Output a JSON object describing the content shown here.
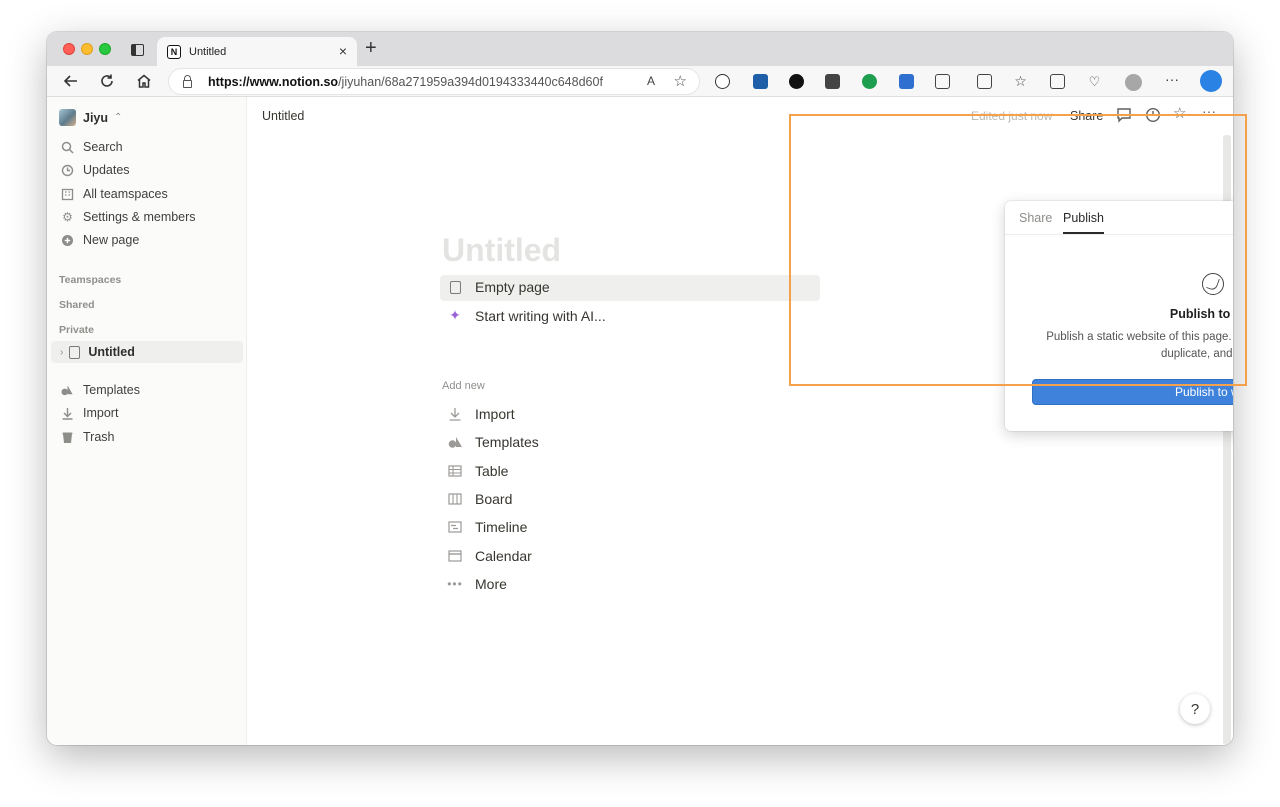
{
  "browser": {
    "tab_title": "Untitled",
    "tab_close": "×",
    "new_tab": "+",
    "url_host": "https://www.notion.so",
    "url_path": "/jiyuhan/68a271959a394d0194333440c648d60f",
    "read_aloud": "A",
    "more": "···"
  },
  "sidebar": {
    "workspace": "Jiyu",
    "nav": [
      {
        "label": "Search",
        "icon": "search-icon"
      },
      {
        "label": "Updates",
        "icon": "clock-icon"
      },
      {
        "label": "All teamspaces",
        "icon": "building-icon"
      },
      {
        "label": "Settings & members",
        "icon": "gear-icon"
      },
      {
        "label": "New page",
        "icon": "plus-circle-icon"
      }
    ],
    "sections": {
      "teamspaces": "Teamspaces",
      "shared": "Shared",
      "private": "Private"
    },
    "private_page": "Untitled",
    "bottom": [
      {
        "label": "Templates",
        "icon": "shapes-icon"
      },
      {
        "label": "Import",
        "icon": "download-icon"
      },
      {
        "label": "Trash",
        "icon": "trash-icon"
      }
    ]
  },
  "header": {
    "breadcrumb": "Untitled",
    "edited": "Edited just now",
    "share": "Share"
  },
  "page": {
    "title_placeholder": "Untitled",
    "options": [
      {
        "label": "Empty page",
        "icon": "page-icon"
      },
      {
        "label": "Start writing with AI...",
        "icon": "sparkle-icon"
      }
    ],
    "add_new_label": "Add new",
    "add_new": [
      {
        "label": "Import",
        "icon": "download-icon"
      },
      {
        "label": "Templates",
        "icon": "shapes-icon"
      },
      {
        "label": "Table",
        "icon": "table-icon"
      },
      {
        "label": "Board",
        "icon": "board-icon"
      },
      {
        "label": "Timeline",
        "icon": "timeline-icon"
      },
      {
        "label": "Calendar",
        "icon": "calendar-icon"
      },
      {
        "label": "More",
        "icon": "more-icon"
      }
    ],
    "help": "?"
  },
  "popup": {
    "tab_share": "Share",
    "tab_publish": "Publish",
    "heading": "Publish to web",
    "description": "Publish a static website of this page. You can allow others to view, duplicate, and remix.",
    "button": "Publish to web"
  },
  "colors": {
    "accent": "#3f82dc",
    "highlight": "#f5a04a"
  }
}
